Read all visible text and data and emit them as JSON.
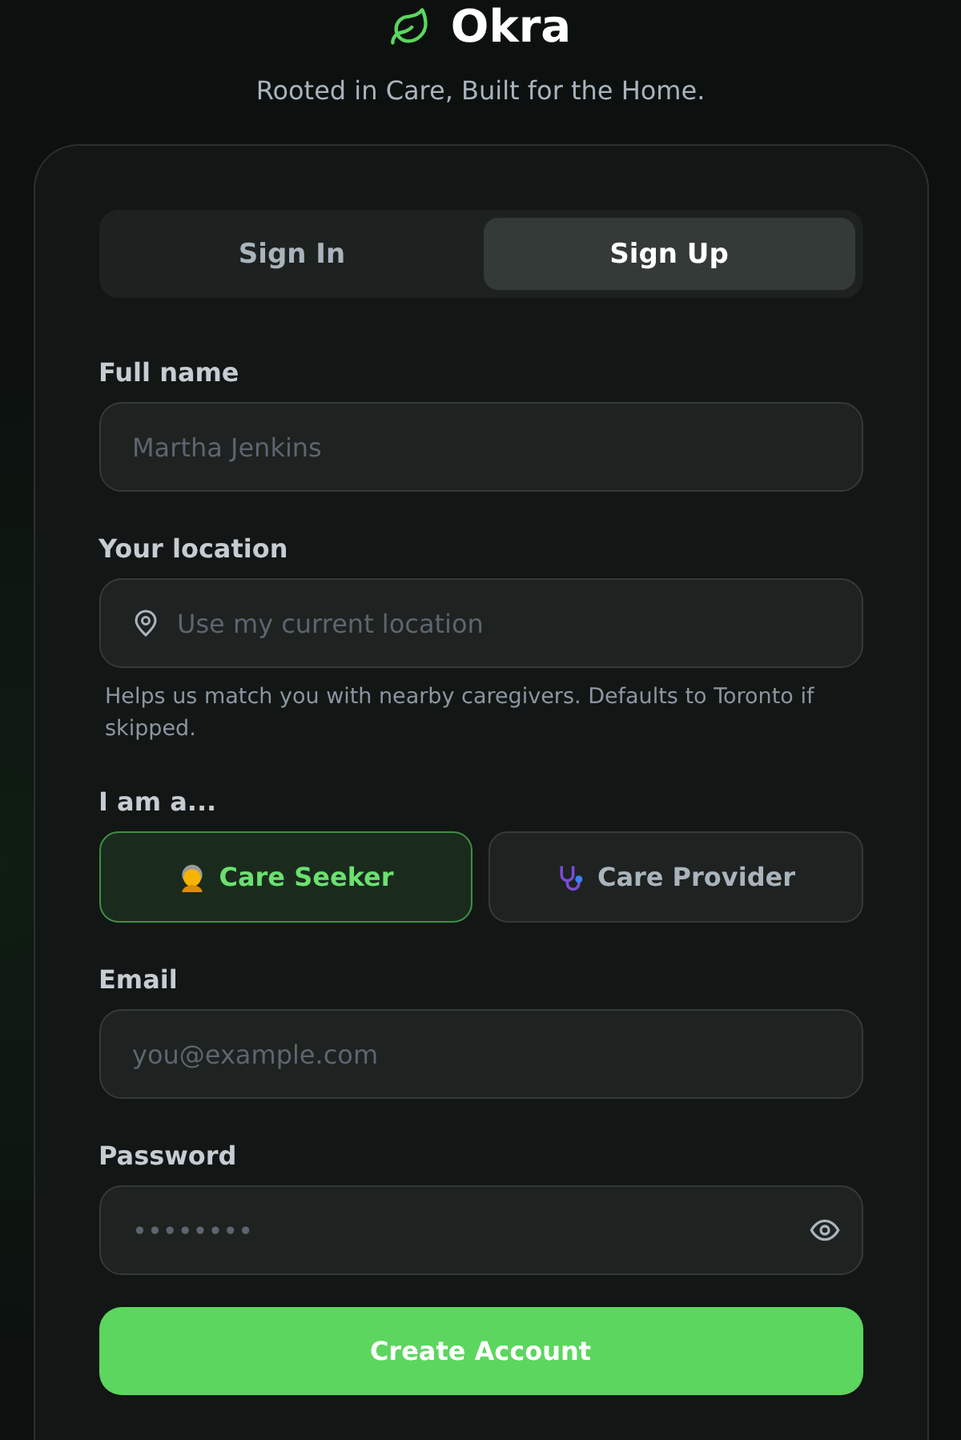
{
  "brand": {
    "name": "Okra",
    "tagline": "Rooted in Care, Built for the Home."
  },
  "tabs": [
    {
      "label": "Sign In",
      "selected": false
    },
    {
      "label": "Sign Up",
      "selected": true
    }
  ],
  "form": {
    "full_name": {
      "label": "Full name",
      "placeholder": "Martha Jenkins"
    },
    "location": {
      "label": "Your location",
      "placeholder": "Use my current location",
      "hint": "Helps us match you with nearby caregivers. Defaults to Toronto if skipped."
    },
    "role": {
      "label": "I am a...",
      "options": [
        {
          "label": "Care Seeker",
          "kind": "seeker",
          "selected": true
        },
        {
          "label": "Care Provider",
          "kind": "provider",
          "selected": false
        }
      ]
    },
    "email": {
      "label": "Email",
      "placeholder": "you@example.com"
    },
    "password": {
      "label": "Password",
      "placeholder": "••••••••"
    },
    "submit": "Create Account"
  }
}
